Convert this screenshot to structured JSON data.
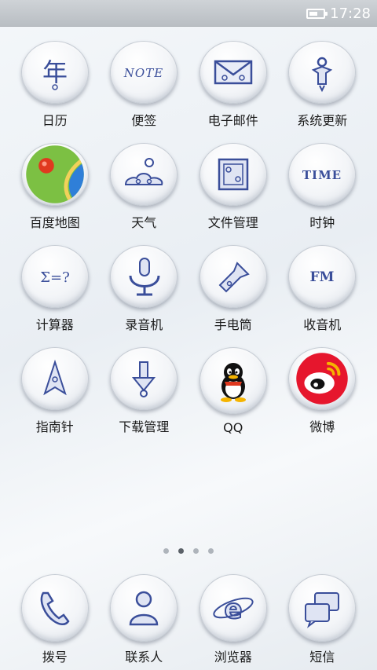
{
  "status": {
    "time": "17:28"
  },
  "apps": [
    {
      "label": "日历",
      "icon": "calendar-icon",
      "glyph": "年"
    },
    {
      "label": "便签",
      "icon": "note-icon",
      "glyph": "NOTE"
    },
    {
      "label": "电子邮件",
      "icon": "mail-icon",
      "glyph": ""
    },
    {
      "label": "系统更新",
      "icon": "update-icon",
      "glyph": ""
    },
    {
      "label": "百度地图",
      "icon": "map-icon",
      "glyph": ""
    },
    {
      "label": "天气",
      "icon": "weather-icon",
      "glyph": ""
    },
    {
      "label": "文件管理",
      "icon": "folder-icon",
      "glyph": ""
    },
    {
      "label": "时钟",
      "icon": "clock-icon",
      "glyph": "TIME"
    },
    {
      "label": "计算器",
      "icon": "calculator-icon",
      "glyph": "Σ=?"
    },
    {
      "label": "录音机",
      "icon": "recorder-icon",
      "glyph": ""
    },
    {
      "label": "手电筒",
      "icon": "flashlight-icon",
      "glyph": ""
    },
    {
      "label": "收音机",
      "icon": "radio-icon",
      "glyph": "FM"
    },
    {
      "label": "指南针",
      "icon": "compass-icon",
      "glyph": ""
    },
    {
      "label": "下载管理",
      "icon": "download-icon",
      "glyph": ""
    },
    {
      "label": "QQ",
      "icon": "qq-icon",
      "glyph": ""
    },
    {
      "label": "微博",
      "icon": "weibo-icon",
      "glyph": ""
    }
  ],
  "pager": {
    "count": 4,
    "active": 1
  },
  "dock": [
    {
      "label": "拨号",
      "icon": "phone-icon"
    },
    {
      "label": "联系人",
      "icon": "contacts-icon"
    },
    {
      "label": "浏览器",
      "icon": "browser-icon"
    },
    {
      "label": "短信",
      "icon": "message-icon"
    }
  ],
  "colors": {
    "porcelain_blue": "#3a4e9a",
    "map_green": "#7cc043",
    "map_blue": "#2f7fd8",
    "map_red": "#e0391f",
    "qq_yellow": "#f5b400",
    "weibo_red": "#e6162d"
  }
}
